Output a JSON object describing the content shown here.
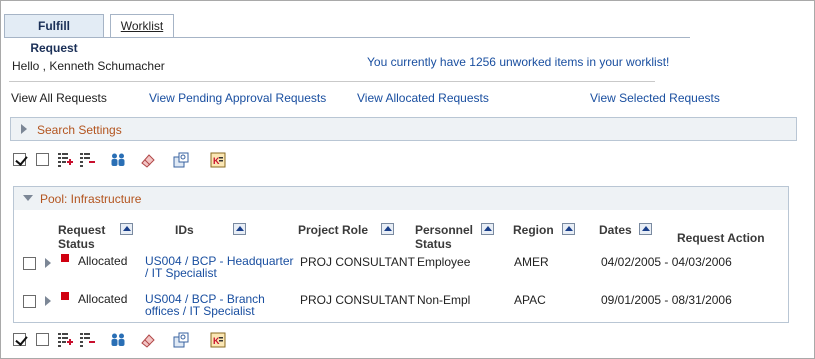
{
  "tabs": {
    "fulfill_label": "Fulfill Request",
    "worklist_label": "Worklist"
  },
  "greeting": "Hello , Kenneth Schumacher",
  "worklist_message": "You currently have 1256 unworked items in your worklist!",
  "nav": {
    "all": "View All Requests",
    "pending": "View Pending Approval Requests",
    "allocated": "View Allocated Requests",
    "selected": "View Selected Requests"
  },
  "search_settings_label": "Search Settings",
  "pool_label": "Pool: Infrastructure",
  "toolbar_icons": [
    "check-all-icon",
    "uncheck-all-icon",
    "add-row-icon",
    "delete-row-icon",
    "people-icon",
    "eraser-icon",
    "find-icon",
    "report-icon"
  ],
  "columns": {
    "request_status": "Request Status",
    "ids": "IDs",
    "project_role": "Project Role",
    "personnel_status": "Personnel Status",
    "region": "Region",
    "dates": "Dates",
    "request_action": "Request Action"
  },
  "rows": [
    {
      "status": "Allocated",
      "status_color": "#d00010",
      "ids_line1": "US004 / BCP - Headquarter",
      "ids_line2": "/ IT Specialist",
      "project_role": "PROJ CONSULTANT",
      "personnel_status": "Employee",
      "region": "AMER",
      "dates": "04/02/2005 - 04/03/2006"
    },
    {
      "status": "Allocated",
      "status_color": "#d00010",
      "ids_line1": "US004 / BCP - Branch",
      "ids_line2": "offices / IT Specialist",
      "project_role": "PROJ CONSULTANT",
      "personnel_status": "Non-Empl",
      "region": "APAC",
      "dates": "09/01/2005 - 08/31/2006"
    }
  ],
  "colors": {
    "link": "#1a4fa0",
    "collapsible_label": "#b3541e",
    "tab_active_bg": "#e3ecf5"
  }
}
